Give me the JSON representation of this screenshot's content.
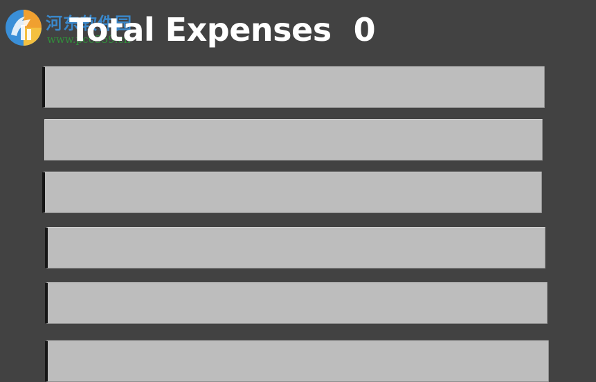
{
  "header": {
    "total_label": "Total Expenses",
    "total_value": "0"
  },
  "watermark": {
    "site_name": "河东软件园",
    "url": "www.pc0359.cn"
  },
  "expense_fields": [
    {
      "value": "",
      "placeholder": ""
    },
    {
      "value": "",
      "placeholder": ""
    },
    {
      "value": "",
      "placeholder": ""
    },
    {
      "value": "",
      "placeholder": ""
    },
    {
      "value": "",
      "placeholder": ""
    },
    {
      "value": "",
      "placeholder": ""
    }
  ],
  "colors": {
    "background": "#424242",
    "field_fill": "#bdbdbd",
    "title_text": "#ffffff",
    "watermark_blue": "#3a8fd8",
    "watermark_green": "#2f9a3a"
  }
}
